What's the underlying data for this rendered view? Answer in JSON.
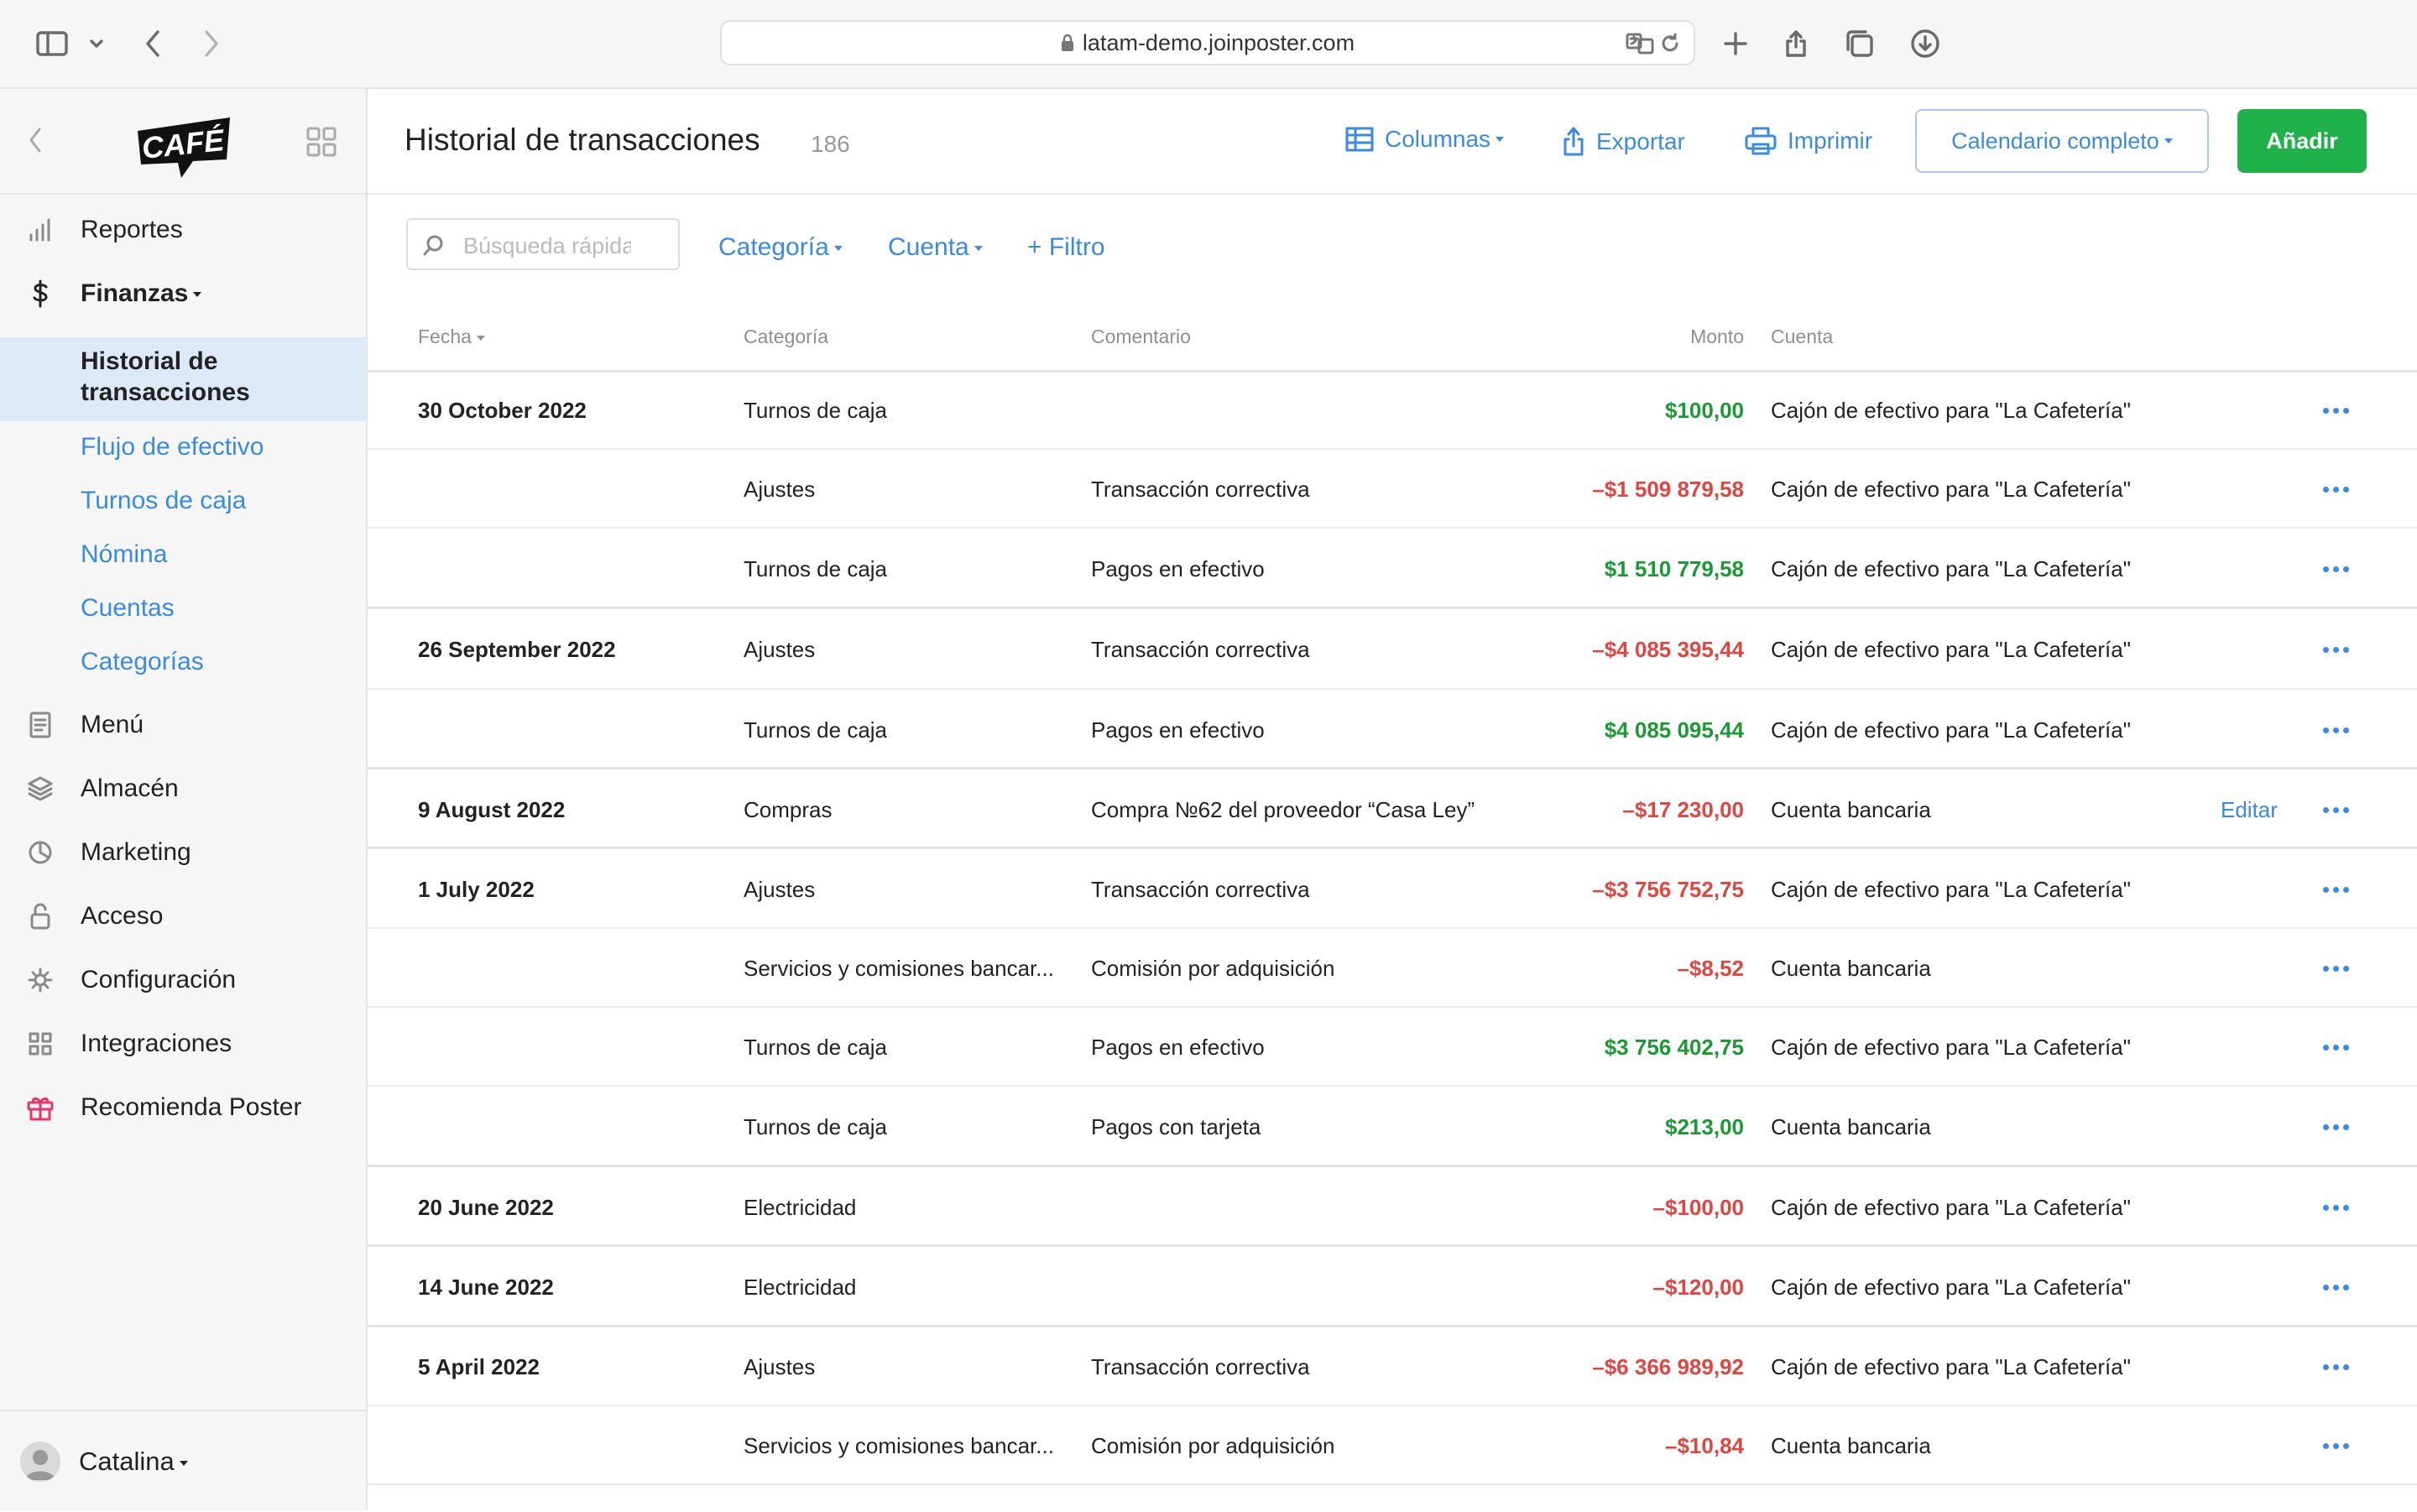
{
  "browser": {
    "url": "latam-demo.joinposter.com"
  },
  "sidebar": {
    "logo_text": "CAFÉ",
    "nav": [
      {
        "label": "Reportes",
        "icon": "bar-chart-icon"
      },
      {
        "label": "Finanzas",
        "icon": "dollar-icon"
      }
    ],
    "finanzas_sub": [
      {
        "label": "Historial de transacciones"
      },
      {
        "label": "Flujo de efectivo"
      },
      {
        "label": "Turnos de caja"
      },
      {
        "label": "Nómina"
      },
      {
        "label": "Cuentas"
      },
      {
        "label": "Categorías"
      }
    ],
    "nav2": [
      {
        "label": "Menú",
        "icon": "document-icon"
      },
      {
        "label": "Almacén",
        "icon": "layers-icon"
      },
      {
        "label": "Marketing",
        "icon": "pie-icon"
      },
      {
        "label": "Acceso",
        "icon": "lock-icon"
      },
      {
        "label": "Configuración",
        "icon": "gear-icon"
      },
      {
        "label": "Integraciones",
        "icon": "grid-icon"
      },
      {
        "label": "Recomienda Poster",
        "icon": "gift-icon"
      }
    ],
    "user": "Catalina"
  },
  "header": {
    "title": "Historial de transacciones",
    "count": "186",
    "columns_label": "Columnas",
    "export_label": "Exportar",
    "print_label": "Imprimir",
    "calendar_label": "Calendario completo",
    "add_label": "Añadir"
  },
  "filters": {
    "search_placeholder": "Búsqueda rápida",
    "category": "Categoría",
    "account": "Cuenta",
    "add_filter": "+ Filtro"
  },
  "table": {
    "columns": {
      "date": "Fecha",
      "category": "Categoría",
      "comment": "Comentario",
      "amount": "Monto",
      "account": "Cuenta"
    },
    "rows": [
      {
        "date": "30 October 2022",
        "category": "Turnos de caja",
        "comment": "",
        "amount": "$100,00",
        "sign": "pos",
        "account": "Cajón de efectivo para \"La Cafetería\"",
        "edit": ""
      },
      {
        "date": "",
        "category": "Ajustes",
        "comment": "Transacción correctiva",
        "amount": "–$1 509 879,58",
        "sign": "neg",
        "account": "Cajón de efectivo para \"La Cafetería\"",
        "edit": ""
      },
      {
        "date": "",
        "category": "Turnos de caja",
        "comment": "Pagos en efectivo",
        "amount": "$1 510 779,58",
        "sign": "pos",
        "account": "Cajón de efectivo para \"La Cafetería\"",
        "edit": ""
      },
      {
        "date": "26 September 2022",
        "category": "Ajustes",
        "comment": "Transacción correctiva",
        "amount": "–$4 085 395,44",
        "sign": "neg",
        "account": "Cajón de efectivo para \"La Cafetería\"",
        "edit": ""
      },
      {
        "date": "",
        "category": "Turnos de caja",
        "comment": "Pagos en efectivo",
        "amount": "$4 085 095,44",
        "sign": "pos",
        "account": "Cajón de efectivo para \"La Cafetería\"",
        "edit": ""
      },
      {
        "date": "9 August 2022",
        "category": "Compras",
        "comment": "Compra №62 del proveedor “Casa Ley”",
        "amount": "–$17 230,00",
        "sign": "neg",
        "account": "Cuenta bancaria",
        "edit": "Editar"
      },
      {
        "date": "1 July 2022",
        "category": "Ajustes",
        "comment": "Transacción correctiva",
        "amount": "–$3 756 752,75",
        "sign": "neg",
        "account": "Cajón de efectivo para \"La Cafetería\"",
        "edit": ""
      },
      {
        "date": "",
        "category": "Servicios y comisiones bancar...",
        "comment": "Comisión por adquisición",
        "amount": "–$8,52",
        "sign": "neg",
        "account": "Cuenta bancaria",
        "edit": ""
      },
      {
        "date": "",
        "category": "Turnos de caja",
        "comment": "Pagos en efectivo",
        "amount": "$3 756 402,75",
        "sign": "pos",
        "account": "Cajón de efectivo para \"La Cafetería\"",
        "edit": ""
      },
      {
        "date": "",
        "category": "Turnos de caja",
        "comment": "Pagos con tarjeta",
        "amount": "$213,00",
        "sign": "pos",
        "account": "Cuenta bancaria",
        "edit": ""
      },
      {
        "date": "20 June 2022",
        "category": "Electricidad",
        "comment": "",
        "amount": "–$100,00",
        "sign": "neg",
        "account": "Cajón de efectivo para \"La Cafetería\"",
        "edit": ""
      },
      {
        "date": "14 June 2022",
        "category": "Electricidad",
        "comment": "",
        "amount": "–$120,00",
        "sign": "neg",
        "account": "Cajón de efectivo para \"La Cafetería\"",
        "edit": ""
      },
      {
        "date": "5 April 2022",
        "category": "Ajustes",
        "comment": "Transacción correctiva",
        "amount": "–$6 366 989,92",
        "sign": "neg",
        "account": "Cajón de efectivo para \"La Cafetería\"",
        "edit": ""
      },
      {
        "date": "",
        "category": "Servicios y comisiones bancar...",
        "comment": "Comisión por adquisición",
        "amount": "–$10,84",
        "sign": "neg",
        "account": "Cuenta bancaria",
        "edit": ""
      }
    ]
  },
  "colors": {
    "accent": "#3a8be0",
    "positive": "#1a9a33",
    "negative": "#e0463f",
    "add_button": "#1fb14a"
  }
}
